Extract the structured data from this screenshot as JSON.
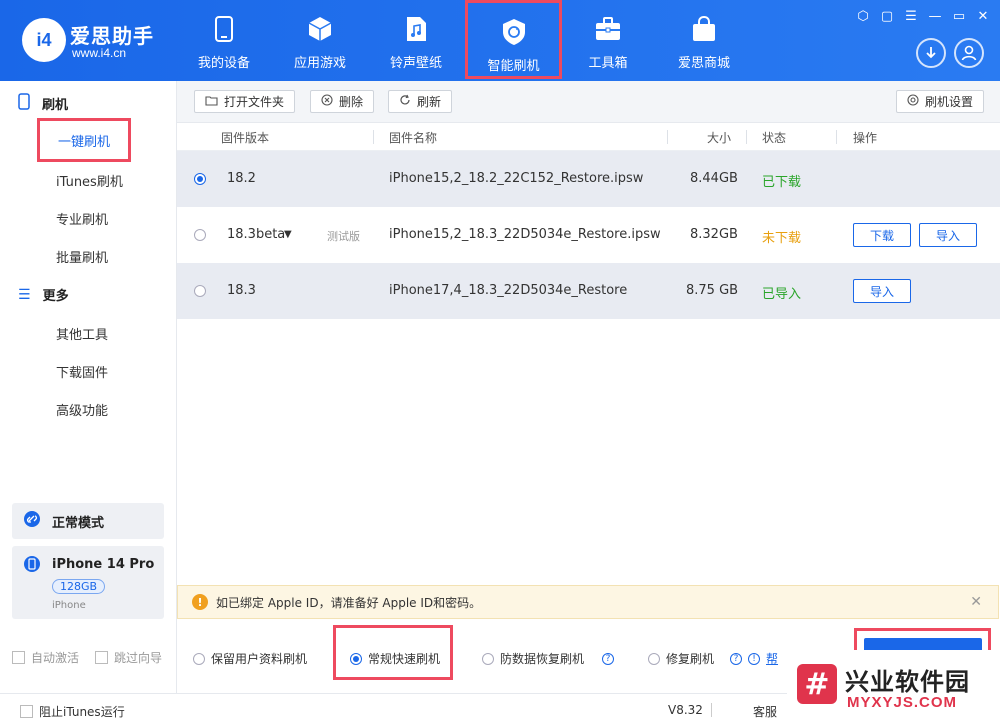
{
  "app": {
    "brand_name": "爱思助手",
    "brand_url": "www.i4.cn",
    "logo_text": "i4"
  },
  "nav": [
    {
      "label": "我的设备",
      "icon": "phone-icon"
    },
    {
      "label": "应用游戏",
      "icon": "cube-icon"
    },
    {
      "label": "铃声壁纸",
      "icon": "music-file-icon"
    },
    {
      "label": "智能刷机",
      "icon": "shield-refresh-icon",
      "active": true
    },
    {
      "label": "工具箱",
      "icon": "toolbox-icon"
    },
    {
      "label": "爱思商城",
      "icon": "shopping-bag-icon"
    }
  ],
  "sidebar": {
    "section1": "刷机",
    "items1": [
      "一键刷机",
      "iTunes刷机",
      "专业刷机",
      "批量刷机"
    ],
    "section2": "更多",
    "items2": [
      "其他工具",
      "下载固件",
      "高级功能"
    ],
    "mode": "正常模式",
    "device_name": "iPhone 14 Pro",
    "device_storage": "128GB",
    "device_type": "iPhone",
    "auto_activate": "自动激活",
    "skip_guide": "跳过向导"
  },
  "toolbar": {
    "open_folder": "打开文件夹",
    "delete": "删除",
    "refresh": "刷新",
    "settings": "刷机设置"
  },
  "table": {
    "headers": {
      "version": "固件版本",
      "name": "固件名称",
      "size": "大小",
      "status": "状态",
      "action": "操作"
    },
    "rows": [
      {
        "version": "18.2",
        "tag": "",
        "name": "iPhone15,2_18.2_22C152_Restore.ipsw",
        "size": "8.44GB",
        "status": "已下载",
        "status_color": "#2aa52a",
        "selected": true
      },
      {
        "version": "18.3beta",
        "tag": "测试版",
        "name": "iPhone15,2_18.3_22D5034e_Restore.ipsw",
        "size": "8.32GB",
        "status": "未下载",
        "status_color": "#e8a010",
        "download": "下载",
        "import": "导入"
      },
      {
        "version": "18.3",
        "tag": "",
        "name": "iPhone17,4_18.3_22D5034e_Restore",
        "size": "8.75 GB",
        "status": "已导入",
        "status_color": "#2aa52a",
        "import": "导入"
      }
    ]
  },
  "notice": "如已绑定 Apple ID，请准备好 Apple ID和密码。",
  "options": {
    "keep_data": "保留用户资料刷机",
    "fast": "常规快速刷机",
    "anti_recovery": "防数据恢复刷机",
    "repair": "修复刷机",
    "help_link": "帮"
  },
  "statusbar": {
    "block_itunes": "阻止iTunes运行",
    "version": "V8.32",
    "service": "客服"
  },
  "watermark": {
    "text": "兴业软件园",
    "url": "MYXYJS.COM"
  },
  "colors": {
    "accent": "#1a67e8",
    "highlight": "#ee4a5f"
  }
}
